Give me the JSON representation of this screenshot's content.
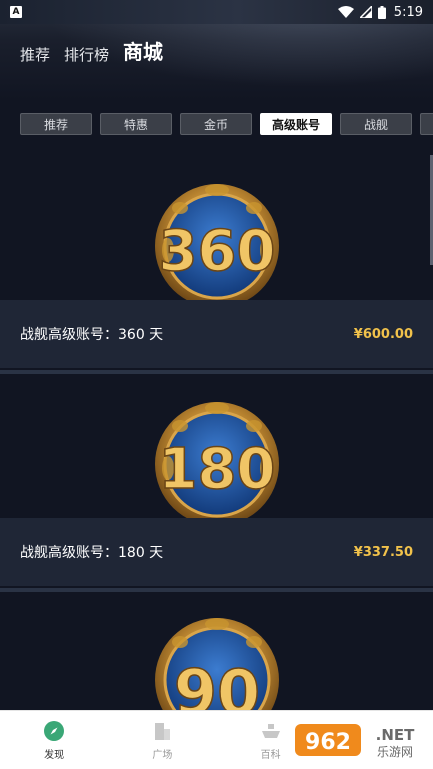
{
  "status_bar": {
    "left_icon_letter": "A",
    "time": "5:19"
  },
  "top_nav": {
    "items": [
      "推荐",
      "排行榜",
      "商城"
    ],
    "active_index": 2
  },
  "categories": {
    "items": [
      "推荐",
      "特惠",
      "金币",
      "高级账号",
      "战舰"
    ],
    "active_index": 3
  },
  "products": [
    {
      "badge_number": "360",
      "name": "战舰高级账号：360 天",
      "price": "¥600.00"
    },
    {
      "badge_number": "180",
      "name": "战舰高级账号：180 天",
      "price": "¥337.50"
    },
    {
      "badge_number": "90"
    }
  ],
  "bottom_nav": {
    "items": [
      {
        "label": "发现",
        "icon": "compass-icon",
        "active": true
      },
      {
        "label": "广场",
        "icon": "building-icon",
        "active": false
      },
      {
        "label": "百科",
        "icon": "ship-icon",
        "active": false
      }
    ]
  },
  "watermark": {
    "text": "962.NET",
    "sub": "乐游网"
  },
  "colors": {
    "price": "#f1c24b",
    "accent_green": "#3aa776",
    "background": "#111522",
    "card_bar": "#1f2636"
  }
}
